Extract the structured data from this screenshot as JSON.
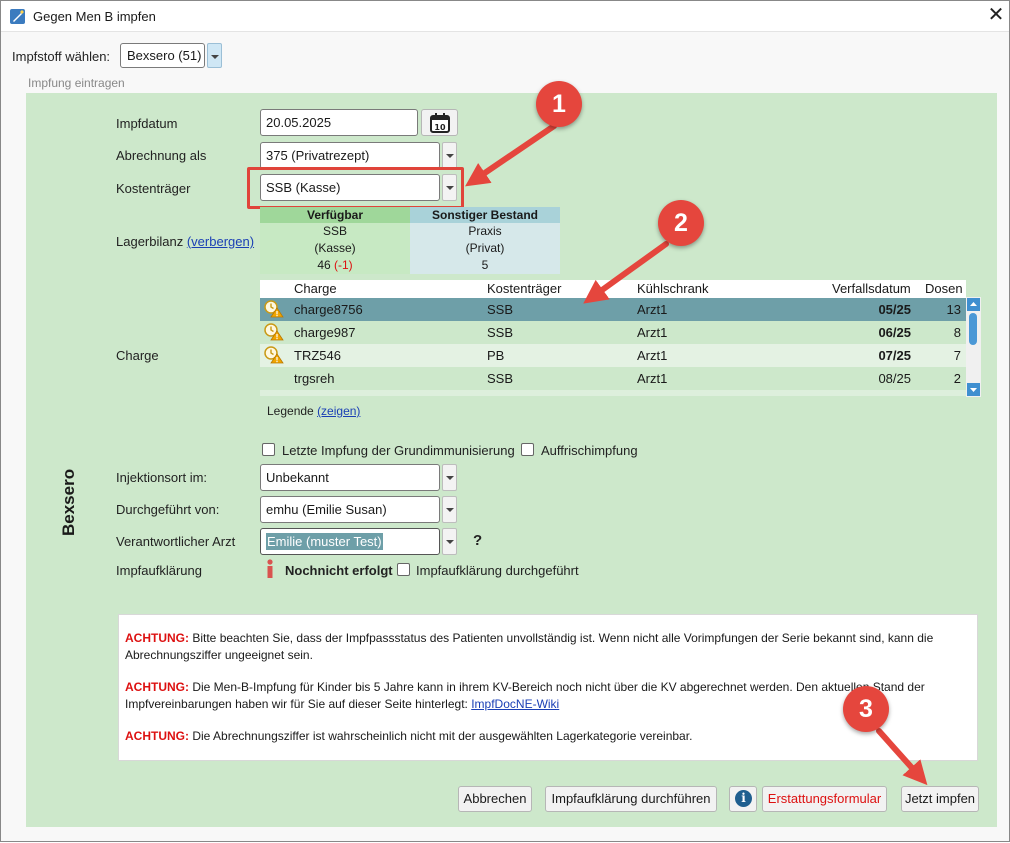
{
  "window": {
    "title": "Gegen Men B impfen",
    "close_glyph": "✕"
  },
  "vaccine": {
    "label": "Impfstoff wählen:",
    "value": "Bexsero (51)"
  },
  "group_caption": "Impfung eintragen",
  "side_label": "Bexsero",
  "form": {
    "impfdatum_label": "Impfdatum",
    "impfdatum_value": "20.05.2025",
    "calendar_day": "10",
    "abrechnung_label": "Abrechnung als",
    "abrechnung_value": "375 (Privatrezept)",
    "kostentraeger_label": "Kostenträger",
    "kostentraeger_value": "SSB (Kasse)",
    "lagerbilanz_label": "Lagerbilanz",
    "lagerbilanz_link": "(verbergen)",
    "charge_label": "Charge",
    "injektionsort_label": "Injektionsort im:",
    "injektionsort_value": "Unbekannt",
    "durchgefuehrt_label": "Durchgeführt von:",
    "durchgefuehrt_value": "emhu (Emilie Susan)",
    "arzt_label": "Verantwortlicher Arzt",
    "arzt_value": "Emilie (muster Test)",
    "arzt_help": "?",
    "aufklaerung_label": "Impfaufklärung",
    "aufklaerung_status": "Nochnicht erfolgt",
    "aufklaerung_checkbox": "Impfaufklärung durchgeführt",
    "letzte_impfung": "Letzte Impfung der Grundimmunisierung",
    "auffrisch": "Auffrischimpfung"
  },
  "bilanz": {
    "verfuegbar_header": "Verfügbar",
    "verfuegbar_line1": "SSB",
    "verfuegbar_line2": "(Kasse)",
    "verfuegbar_count": "46",
    "verfuegbar_delta": "(-1)",
    "sonstiger_header": "Sonstiger Bestand",
    "sonstiger_line1": "Praxis",
    "sonstiger_line2": "(Privat)",
    "sonstiger_count": "5",
    "colors": {
      "verfuegbar_header": "#9fd79a",
      "verfuegbar_body": "#c7e9c3",
      "sonstiger_header": "#a9d2d9",
      "sonstiger_body": "#d6e8ea"
    }
  },
  "charge_table": {
    "headers": {
      "charge": "Charge",
      "kostentraeger": "Kostenträger",
      "kuehlschrank": "Kühlschrank",
      "verfall": "Verfallsdatum",
      "dosen": "Dosen"
    },
    "rows": [
      {
        "charge": "charge8756",
        "kostentraeger": "SSB",
        "kuehlschrank": "Arzt1",
        "verfall": "05/25",
        "dosen": "13",
        "warn": true,
        "bold": true,
        "selected": true
      },
      {
        "charge": "charge987",
        "kostentraeger": "SSB",
        "kuehlschrank": "Arzt1",
        "verfall": "06/25",
        "dosen": "8",
        "warn": true,
        "bold": true,
        "selected": false
      },
      {
        "charge": "TRZ546",
        "kostentraeger": "PB",
        "kuehlschrank": "Arzt1",
        "verfall": "07/25",
        "dosen": "7",
        "warn": true,
        "bold": true,
        "selected": false
      },
      {
        "charge": "trgsreh",
        "kostentraeger": "SSB",
        "kuehlschrank": "Arzt1",
        "verfall": "08/25",
        "dosen": "2",
        "warn": false,
        "bold": false,
        "selected": false
      }
    ],
    "legend_label": "Legende",
    "legend_link": "(zeigen)",
    "selected_color": "#6e9fa8"
  },
  "warnings": {
    "w1_prefix": "ACHTUNG:",
    "w1_text": "Bitte beachten Sie, dass der Impfpassstatus des Patienten unvollständig ist. Wenn nicht alle Vorimpfungen der Serie bekannt sind, kann die Abrechnungsziffer ungeeignet sein.",
    "w2_prefix": "ACHTUNG:",
    "w2_text": "Die Men-B-Impfung für Kinder bis 5 Jahre kann in ihrem KV-Bereich noch nicht über die KV abgerechnet werden. Den aktuellen Stand der Impfvereinbarungen haben wir für Sie auf dieser Seite hinterlegt:",
    "w2_link": "ImpfDocNE-Wiki",
    "w3_prefix": "ACHTUNG:",
    "w3_text": "Die Abrechnungsziffer ist wahrscheinlich nicht mit der ausgewählten Lagerkategorie vereinbar."
  },
  "buttons": {
    "abbrechen": "Abbrechen",
    "aufklaerung": "Impfaufklärung durchführen",
    "info": "i",
    "erstattung": "Erstattungsformular",
    "impfen": "Jetzt impfen"
  },
  "markers": [
    "1",
    "2",
    "3"
  ],
  "colors": {
    "panel": "#cde8cb",
    "marker": "#e5463d",
    "highlight_box": "#e0443a",
    "warning_red": "#dd1111",
    "link": "#1a3fb5"
  }
}
